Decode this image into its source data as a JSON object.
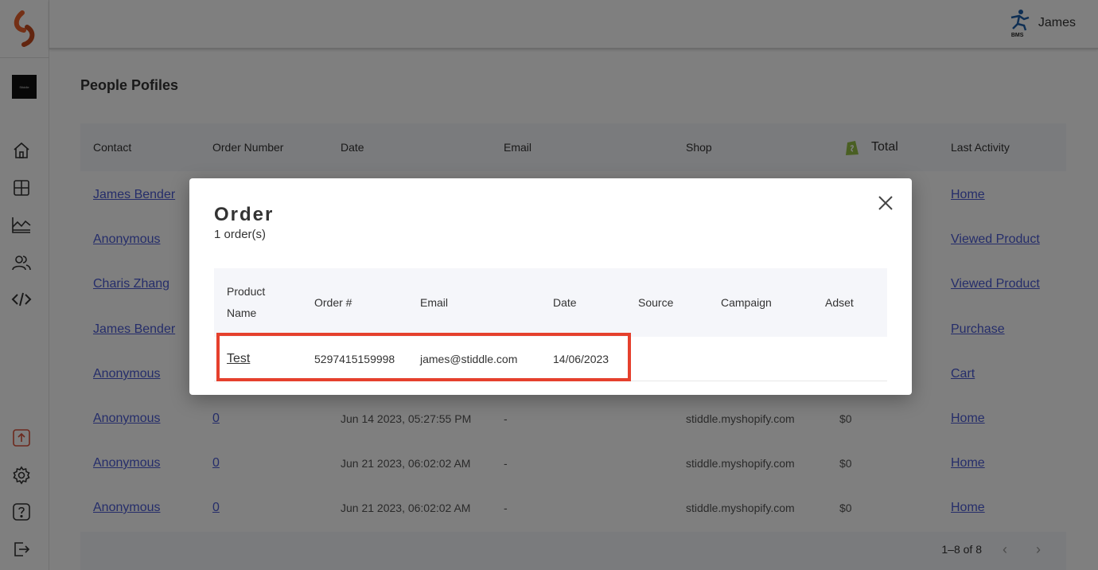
{
  "topbar": {
    "user_name": "James",
    "user_badge": "BMS"
  },
  "sidebar": {
    "brand_label": "Stiddle",
    "items": [
      {
        "icon": "home-icon"
      },
      {
        "icon": "dashboard-icon"
      },
      {
        "icon": "analytics-icon"
      },
      {
        "icon": "people-icon"
      },
      {
        "icon": "code-icon"
      },
      {
        "icon": "upload-icon"
      },
      {
        "icon": "settings-icon"
      },
      {
        "icon": "help-icon"
      },
      {
        "icon": "logout-icon"
      }
    ]
  },
  "page": {
    "title": "People Pofiles",
    "columns": [
      "Contact",
      "Order Number",
      "Date",
      "Email",
      "Shop",
      "Total",
      "Last Activity"
    ],
    "rows": [
      {
        "contact": "James Bender",
        "order": "",
        "date": "",
        "email": "",
        "shop": "",
        "total": "",
        "activity": "Home"
      },
      {
        "contact": "Anonymous",
        "order": "",
        "date": "",
        "email": "",
        "shop": "",
        "total": "",
        "activity": "Viewed Product"
      },
      {
        "contact": "Charis Zhang",
        "order": "",
        "date": "",
        "email": "",
        "shop": "",
        "total": "",
        "activity": "Viewed Product"
      },
      {
        "contact": "James Bender",
        "order": "",
        "date": "",
        "email": "",
        "shop": "",
        "total": "",
        "activity": "Purchase"
      },
      {
        "contact": "Anonymous",
        "order": "",
        "date": "",
        "email": "",
        "shop": "",
        "total": "",
        "activity": "Cart"
      },
      {
        "contact": "Anonymous",
        "order": "0",
        "date": "Jun 14 2023, 05:27:55 PM",
        "email": "-",
        "shop": "stiddle.myshopify.com",
        "total": "$0",
        "activity": "Home"
      },
      {
        "contact": "Anonymous",
        "order": "0",
        "date": "Jun 21 2023, 06:02:02 AM",
        "email": "-",
        "shop": "stiddle.myshopify.com",
        "total": "$0",
        "activity": "Home"
      },
      {
        "contact": "Anonymous",
        "order": "0",
        "date": "Jun 21 2023, 06:02:02 AM",
        "email": "-",
        "shop": "stiddle.myshopify.com",
        "total": "$0",
        "activity": "Home"
      }
    ],
    "pagination": "1–8 of 8"
  },
  "modal": {
    "title": "Order",
    "subtitle": "1 order(s)",
    "columns": [
      "Product Name",
      "Order #",
      "Email",
      "Date",
      "Source",
      "Campaign",
      "Adset"
    ],
    "rows": [
      {
        "product": "Test",
        "order": "5297415159998",
        "email": "james@stiddle.com",
        "date": "14/06/2023",
        "source": "",
        "campaign": "",
        "adset": ""
      }
    ]
  },
  "colors": {
    "accent": "#4a5bd4",
    "highlight": "#e5402d",
    "shopify_green": "#95bf47",
    "logo_orange": "#e8612c"
  }
}
